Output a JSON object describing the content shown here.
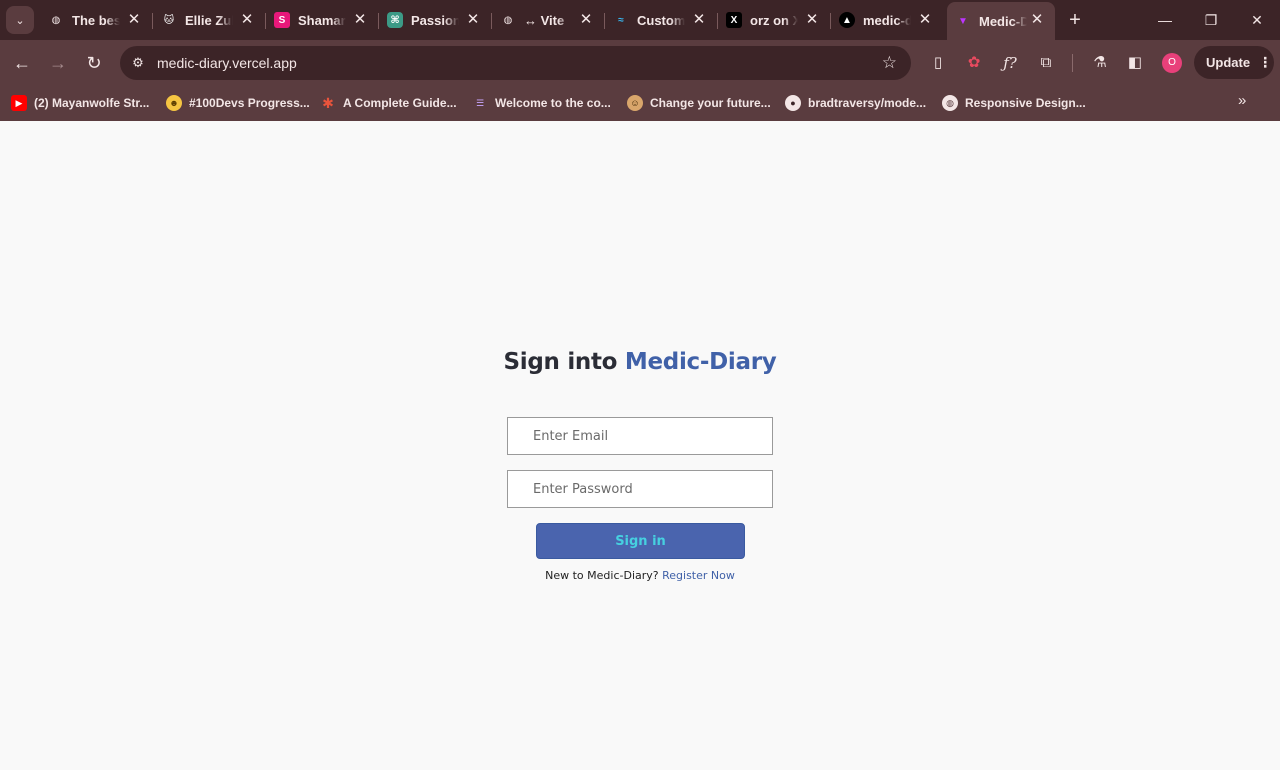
{
  "browser": {
    "tabs": [
      {
        "title": "The best",
        "favicon": "globe-icon",
        "active": false
      },
      {
        "title": "Ellie Zul",
        "favicon": "cat-icon",
        "active": false
      },
      {
        "title": "Shamar",
        "favicon": "s-logo-icon",
        "active": false
      },
      {
        "title": "Passion",
        "favicon": "openai-icon",
        "active": false
      },
      {
        "title": "↔ Vite",
        "favicon": "globe-icon",
        "active": false
      },
      {
        "title": "Custom",
        "favicon": "tailwind-icon",
        "active": false
      },
      {
        "title": "orz on X",
        "favicon": "x-logo-icon",
        "active": false
      },
      {
        "title": "medic-d",
        "favicon": "vercel-icon",
        "active": false
      },
      {
        "title": "Medic-D",
        "favicon": "vite-icon",
        "active": true
      }
    ],
    "address_bar": {
      "url": "medic-diary.vercel.app"
    },
    "profile_initial": "O",
    "update_label": "Update",
    "bookmarks": [
      {
        "label": "(2) Mayanwolfe Str...",
        "icon": "youtube-icon"
      },
      {
        "label": "#100Devs Progress...",
        "icon": "grin-emoji-icon"
      },
      {
        "label": "A Complete Guide...",
        "icon": "asterisk-icon"
      },
      {
        "label": "Welcome to the co...",
        "icon": "stack-icon"
      },
      {
        "label": "Change your future...",
        "icon": "avatar-icon"
      },
      {
        "label": "bradtraversy/mode...",
        "icon": "github-icon"
      },
      {
        "label": "Responsive Design...",
        "icon": "globe-icon"
      }
    ]
  },
  "signin": {
    "heading_prefix": "Sign into",
    "heading_brand": "Medic-Diary",
    "email_placeholder": "Enter Email",
    "password_placeholder": "Enter Password",
    "button_label": "Sign in",
    "register_prompt": "New to Medic-Diary?",
    "register_link": "Register Now"
  },
  "colors": {
    "brand_blue": "#4061a8",
    "button_bg": "#4a64ae",
    "button_text": "#46d0e0",
    "browser_frame": "#5a3c3f"
  }
}
